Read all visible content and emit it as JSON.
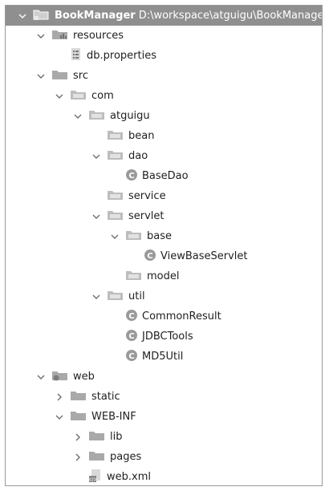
{
  "tree": [
    {
      "label": "BookManager",
      "path": "D:\\workspace\\atguigu\\BookManager",
      "level": 0,
      "arrow": "down",
      "icon": "module",
      "selected": true,
      "bold": true
    },
    {
      "label": "resources",
      "level": 1,
      "arrow": "down",
      "icon": "resources-folder"
    },
    {
      "label": "db.properties",
      "level": 2,
      "arrow": "none",
      "icon": "properties-file"
    },
    {
      "label": "src",
      "level": 1,
      "arrow": "down",
      "icon": "folder"
    },
    {
      "label": "com",
      "level": 2,
      "arrow": "down",
      "icon": "package"
    },
    {
      "label": "atguigu",
      "level": 3,
      "arrow": "down",
      "icon": "package"
    },
    {
      "label": "bean",
      "level": 4,
      "arrow": "none",
      "icon": "package"
    },
    {
      "label": "dao",
      "level": 4,
      "arrow": "down",
      "icon": "package"
    },
    {
      "label": "BaseDao",
      "level": 5,
      "arrow": "none",
      "icon": "class"
    },
    {
      "label": "service",
      "level": 4,
      "arrow": "none",
      "icon": "package"
    },
    {
      "label": "servlet",
      "level": 4,
      "arrow": "down",
      "icon": "package"
    },
    {
      "label": "base",
      "level": 5,
      "arrow": "down",
      "icon": "package"
    },
    {
      "label": "ViewBaseServlet",
      "level": 6,
      "arrow": "none",
      "icon": "class"
    },
    {
      "label": "model",
      "level": 5,
      "arrow": "none",
      "icon": "package"
    },
    {
      "label": "util",
      "level": 4,
      "arrow": "down",
      "icon": "package"
    },
    {
      "label": "CommonResult",
      "level": 5,
      "arrow": "none",
      "icon": "class"
    },
    {
      "label": "JDBCTools",
      "level": 5,
      "arrow": "none",
      "icon": "class"
    },
    {
      "label": "MD5Util",
      "level": 5,
      "arrow": "none",
      "icon": "class"
    },
    {
      "label": "web",
      "level": 1,
      "arrow": "down",
      "icon": "web-folder"
    },
    {
      "label": "static",
      "level": 2,
      "arrow": "right",
      "icon": "folder"
    },
    {
      "label": "WEB-INF",
      "level": 2,
      "arrow": "down",
      "icon": "folder"
    },
    {
      "label": "lib",
      "level": 3,
      "arrow": "right",
      "icon": "folder"
    },
    {
      "label": "pages",
      "level": 3,
      "arrow": "right",
      "icon": "folder"
    },
    {
      "label": "web.xml",
      "level": 3,
      "arrow": "none",
      "icon": "xml-file"
    }
  ],
  "colors": {
    "selected_bg": "#8f8f8f",
    "folder": "#a9a9a9",
    "class_circle": "#9a9a9a",
    "text": "#1f1f1f"
  }
}
